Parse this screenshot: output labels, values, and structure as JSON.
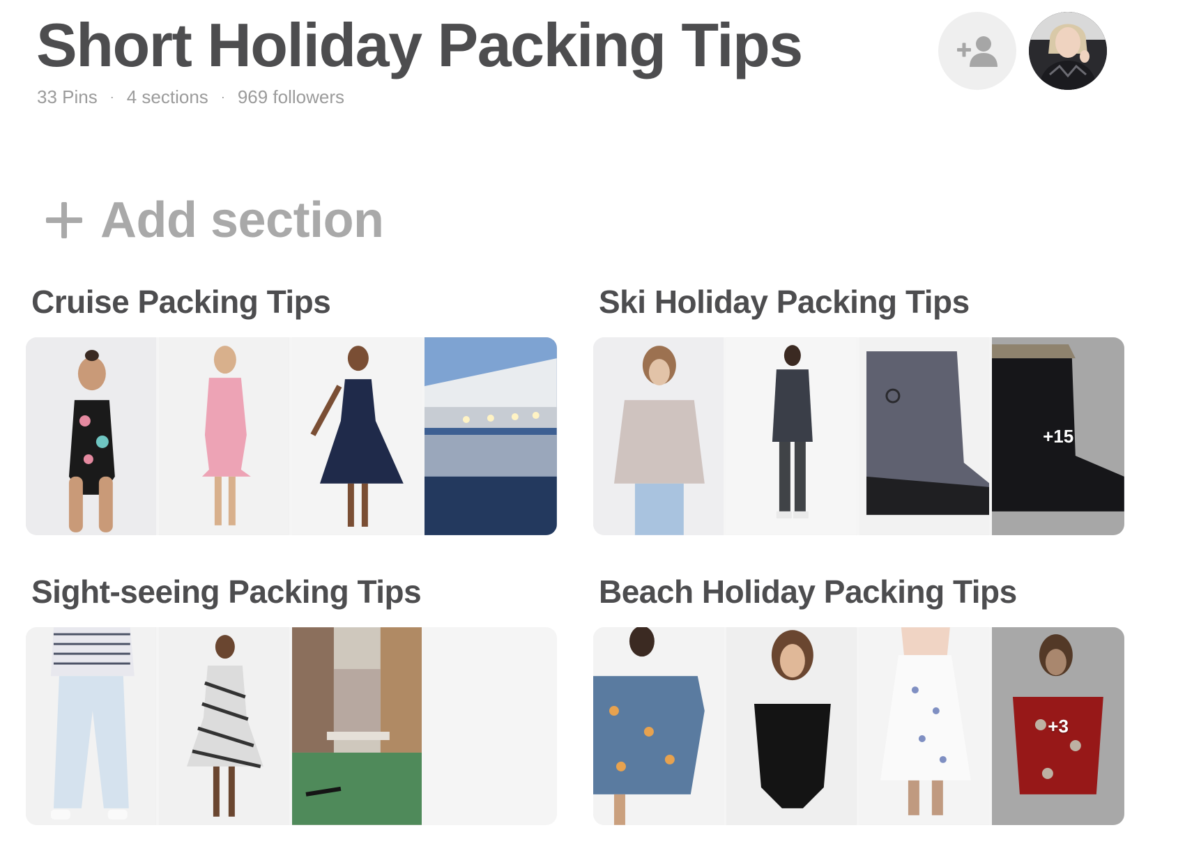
{
  "board": {
    "title": "Short Holiday Packing Tips",
    "pins": "33 Pins",
    "sections": "4 sections",
    "followers": "969 followers",
    "separator": "·"
  },
  "header": {
    "collaborator_icon": "add-person-icon",
    "avatar_icon": "profile-avatar"
  },
  "add_section": {
    "label": "Add section",
    "icon": "plus-icon"
  },
  "sections_list": [
    {
      "title": "Cruise Packing Tips",
      "thumbnails": [
        "swimsuit-floral",
        "pink-dress",
        "navy-dress",
        "cruise-ship"
      ],
      "more_count": ""
    },
    {
      "title": "Ski Holiday Packing Tips",
      "thumbnails": [
        "knit-sweater",
        "dark-top-jeans",
        "grey-snow-boot",
        "black-snow-boot"
      ],
      "more_count": "+15"
    },
    {
      "title": "Sight-seeing Packing Tips",
      "thumbnails": [
        "striped-top-jeans",
        "striped-wrap-dress",
        "venice-canal",
        "empty"
      ],
      "more_count": ""
    },
    {
      "title": "Beach Holiday Packing Tips",
      "thumbnails": [
        "blue-offshoulder-dress",
        "black-swimsuit",
        "floral-skirt",
        "red-floral-dress"
      ],
      "more_count": "+3"
    }
  ],
  "colors": {
    "title": "#4d4d4f",
    "meta": "#9b9b9b",
    "add_section": "#a9a9a9",
    "tile_bg": "#ececec"
  }
}
